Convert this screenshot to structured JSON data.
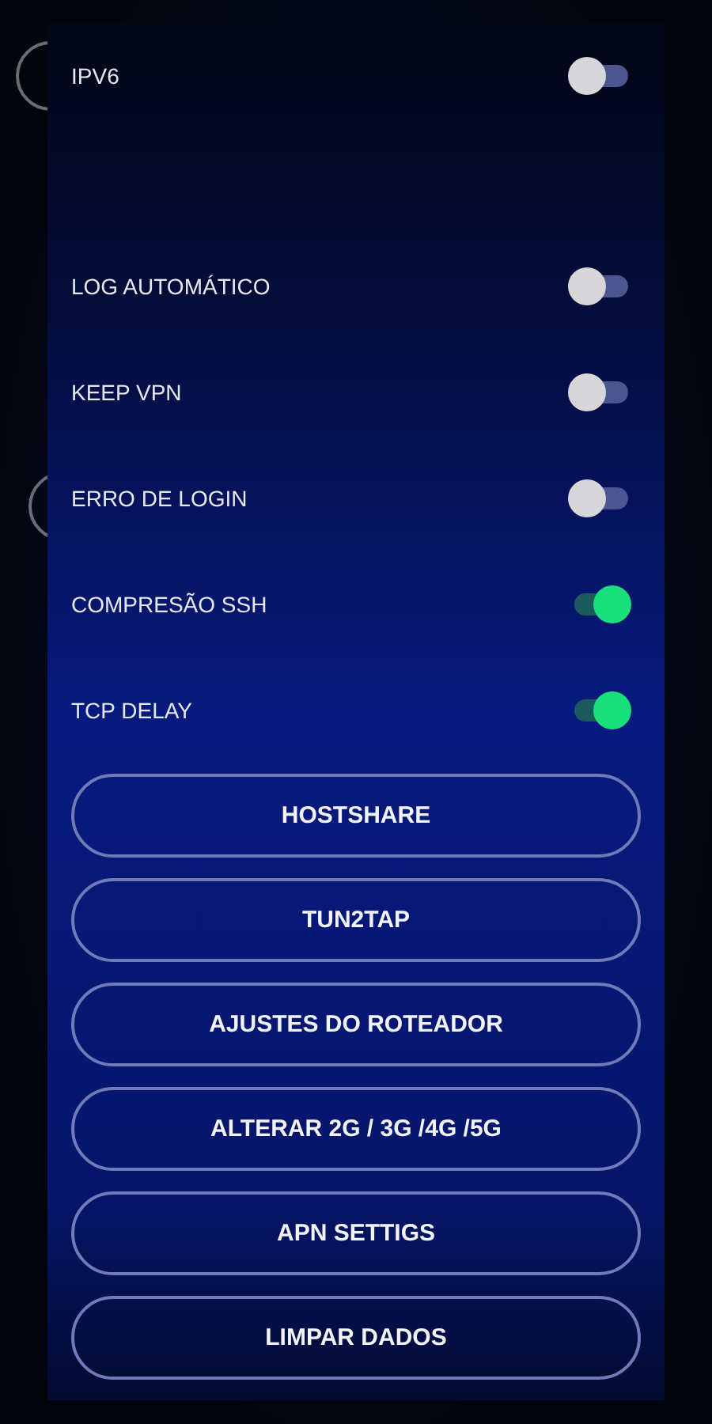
{
  "toggles": [
    {
      "label": "IPV6",
      "on": false
    },
    {
      "label": "LOG AUTOMÁTICO",
      "on": false
    },
    {
      "label": "KEEP VPN",
      "on": false
    },
    {
      "label": "ERRO DE LOGIN",
      "on": false
    },
    {
      "label": "COMPRESÃO SSH",
      "on": true
    },
    {
      "label": "TCP DELAY",
      "on": true
    }
  ],
  "buttons": [
    "HOSTSHARE",
    "TUN2TAP",
    "AJUSTES DO ROTEADOR",
    "ALTERAR 2G / 3G /4G /5G",
    "APN SETTIGS",
    "LIMPAR DADOS"
  ]
}
